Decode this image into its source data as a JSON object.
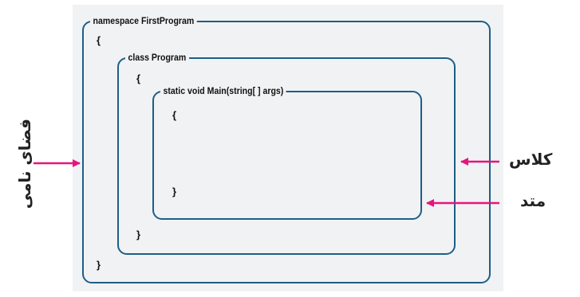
{
  "code": {
    "namespace_line": "namespace FirstProgram",
    "class_line": "class Program",
    "method_line": "static void Main(string[ ] args)",
    "open_brace": "{",
    "close_brace": "}"
  },
  "labels": {
    "namespace": "فضای نامی",
    "class": "کلاس",
    "method": "متد"
  },
  "colors": {
    "box_border": "#1c5f86",
    "arrow": "#e6157d",
    "panel_background": "#f1f2f4"
  }
}
